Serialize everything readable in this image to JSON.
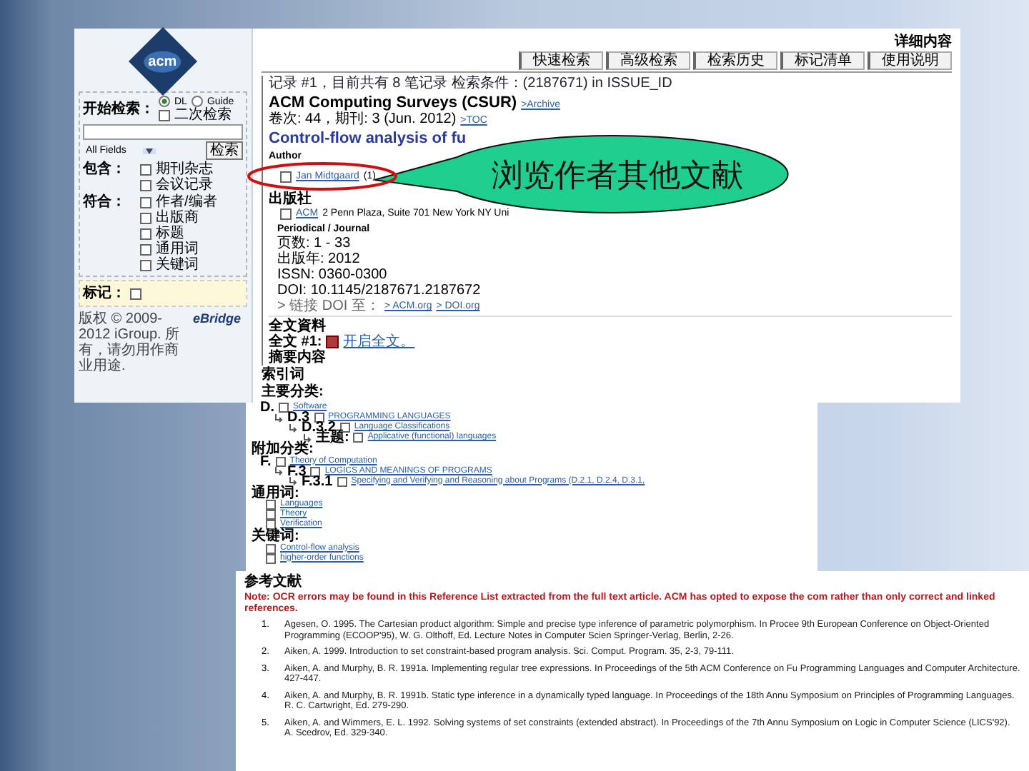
{
  "sidebar": {
    "logo": "acm",
    "search_label": "开始检索：",
    "scopes": [
      {
        "label": "DL",
        "selected": true
      },
      {
        "label": "Guide",
        "selected": false
      }
    ],
    "refine": {
      "label": "二次检索",
      "checked": false
    },
    "field_select": "All Fields",
    "search_button": "检索",
    "groups": [
      {
        "label": "包含：",
        "options": [
          {
            "label": "期刊杂志",
            "checked": false
          },
          {
            "label": "会议记录",
            "checked": false
          }
        ]
      },
      {
        "label": "符合：",
        "options": [
          {
            "label": "作者/编者",
            "checked": false
          },
          {
            "label": "出版商",
            "checked": false
          },
          {
            "label": "标题",
            "checked": false
          },
          {
            "label": "通用词",
            "checked": false
          },
          {
            "label": "关键词",
            "checked": false
          }
        ]
      }
    ],
    "marked": {
      "label": "标记：",
      "checked": false
    },
    "copyright": "版权 © 2009-2012 iGroup. 所有，请勿用作商业用途.",
    "brand": "eBridge"
  },
  "header": {
    "title": "详细内容",
    "tabs": [
      {
        "label": "快速检索",
        "selected": false
      },
      {
        "label": "高级检索",
        "selected": false
      },
      {
        "label": "检索历史",
        "selected": false
      },
      {
        "label": "标记清单",
        "selected": false
      },
      {
        "label": "使用说明",
        "selected": false
      }
    ]
  },
  "record": {
    "summary": "记录 #1，目前共有 8 笔记录 检索条件：(2187671) in ISSUE_ID",
    "journal": "ACM Computing Surveys (CSUR)",
    "journal_link": ">Archive",
    "issue": "卷次: 44，期刊: 3 (Jun. 2012)",
    "issue_link": ">TOC",
    "article_title": "Control-flow analysis of fu",
    "author_label": "Author",
    "authors": [
      {
        "name": "Jan Midtgaard",
        "count": "(1)",
        "checked": false
      }
    ],
    "publisher_label": "出版社",
    "publisher": {
      "name": "ACM",
      "address": "2 Penn Plaza, Suite 701 New York NY Uni",
      "checked": false
    },
    "type": "Periodical / Journal",
    "details": [
      "页数: 1 - 33",
      "出版年: 2012",
      "ISSN: 0360-0300",
      "DOI: 10.1145/2187671.2187672"
    ],
    "doi_links": {
      "label": "> 链接 DOI 至：",
      "links": [
        "> ACM.org",
        "> DOI.org"
      ]
    },
    "fulltext_label": "全文資料",
    "fulltext": {
      "label": "全文 #1:",
      "link": "开启全文。"
    },
    "abstract_label": "摘要内容",
    "index_label": "索引词",
    "primary_label": "主要分类:"
  },
  "classification": {
    "primary": [
      {
        "code": "D.",
        "label": "Software",
        "checked": false,
        "children": [
          {
            "code": "D.3",
            "label": "PROGRAMMING LANGUAGES",
            "checked": false,
            "children": [
              {
                "code": "D.3.2",
                "label": "Language Classifications",
                "checked": false,
                "children": [
                  {
                    "code": "主题:",
                    "label": "Applicative (functional) languages",
                    "checked": false
                  }
                ]
              }
            ]
          }
        ]
      }
    ],
    "additional_label": "附加分类:",
    "additional": [
      {
        "code": "F.",
        "label": "Theory of Computation",
        "checked": false,
        "children": [
          {
            "code": "F.3",
            "label": "LOGICS AND MEANINGS OF PROGRAMS",
            "checked": false,
            "children": [
              {
                "code": "F.3.1",
                "label": "Specifying and Verifying and Reasoning about Programs (D.2.1, D.2.4, D.3.1,",
                "checked": false
              }
            ]
          }
        ]
      }
    ],
    "general_label": "通用词:",
    "general_terms": [
      {
        "label": "Languages",
        "checked": false
      },
      {
        "label": "Theory",
        "checked": false
      },
      {
        "label": "Verification",
        "checked": false
      }
    ],
    "keywords_label": "关键词:",
    "keywords": [
      {
        "label": "Control-flow analysis",
        "checked": false
      },
      {
        "label": "higher-order functions",
        "checked": false
      }
    ]
  },
  "references": {
    "title": "参考文献",
    "note": "Note: OCR errors may be found in this Reference List extracted from the full text article. ACM has opted to expose the com rather than only correct and linked references.",
    "items": [
      {
        "number": "1.",
        "text": "Agesen, O. 1995. The Cartesian product algorithm: Simple and precise type inference of parametric polymorphism. In Procee 9th European Conference on Object-Oriented Programming (ECOOP'95), W. G. Olthoff, Ed. Lecture Notes in Computer Scien Springer-Verlag, Berlin, 2-26."
      },
      {
        "number": "2.",
        "text": "Aiken, A. 1999. Introduction to set constraint-based program analysis. Sci. Comput. Program. 35, 2-3, 79-111."
      },
      {
        "number": "3.",
        "text": "Aiken, A. and Murphy, B. R. 1991a. Implementing regular tree expressions. In Proceedings of the 5th ACM Conference on Fu Programming Languages and Computer Architecture. 427-447."
      },
      {
        "number": "4.",
        "text": "Aiken, A. and Murphy, B. R. 1991b. Static type inference in a dynamically typed language. In Proceedings of the 18th Annu Symposium on Principles of Programming Languages. R. C. Cartwright, Ed. 279-290."
      },
      {
        "number": "5.",
        "text": "Aiken, A. and Wimmers, E. L. 1992. Solving systems of set constraints (extended abstract). In Proceedings of the 7th Annu Symposium on Logic in Computer Science (LICS'92). A. Scedrov, Ed. 329-340."
      }
    ]
  },
  "callout": {
    "text": "浏览作者其他文献"
  }
}
